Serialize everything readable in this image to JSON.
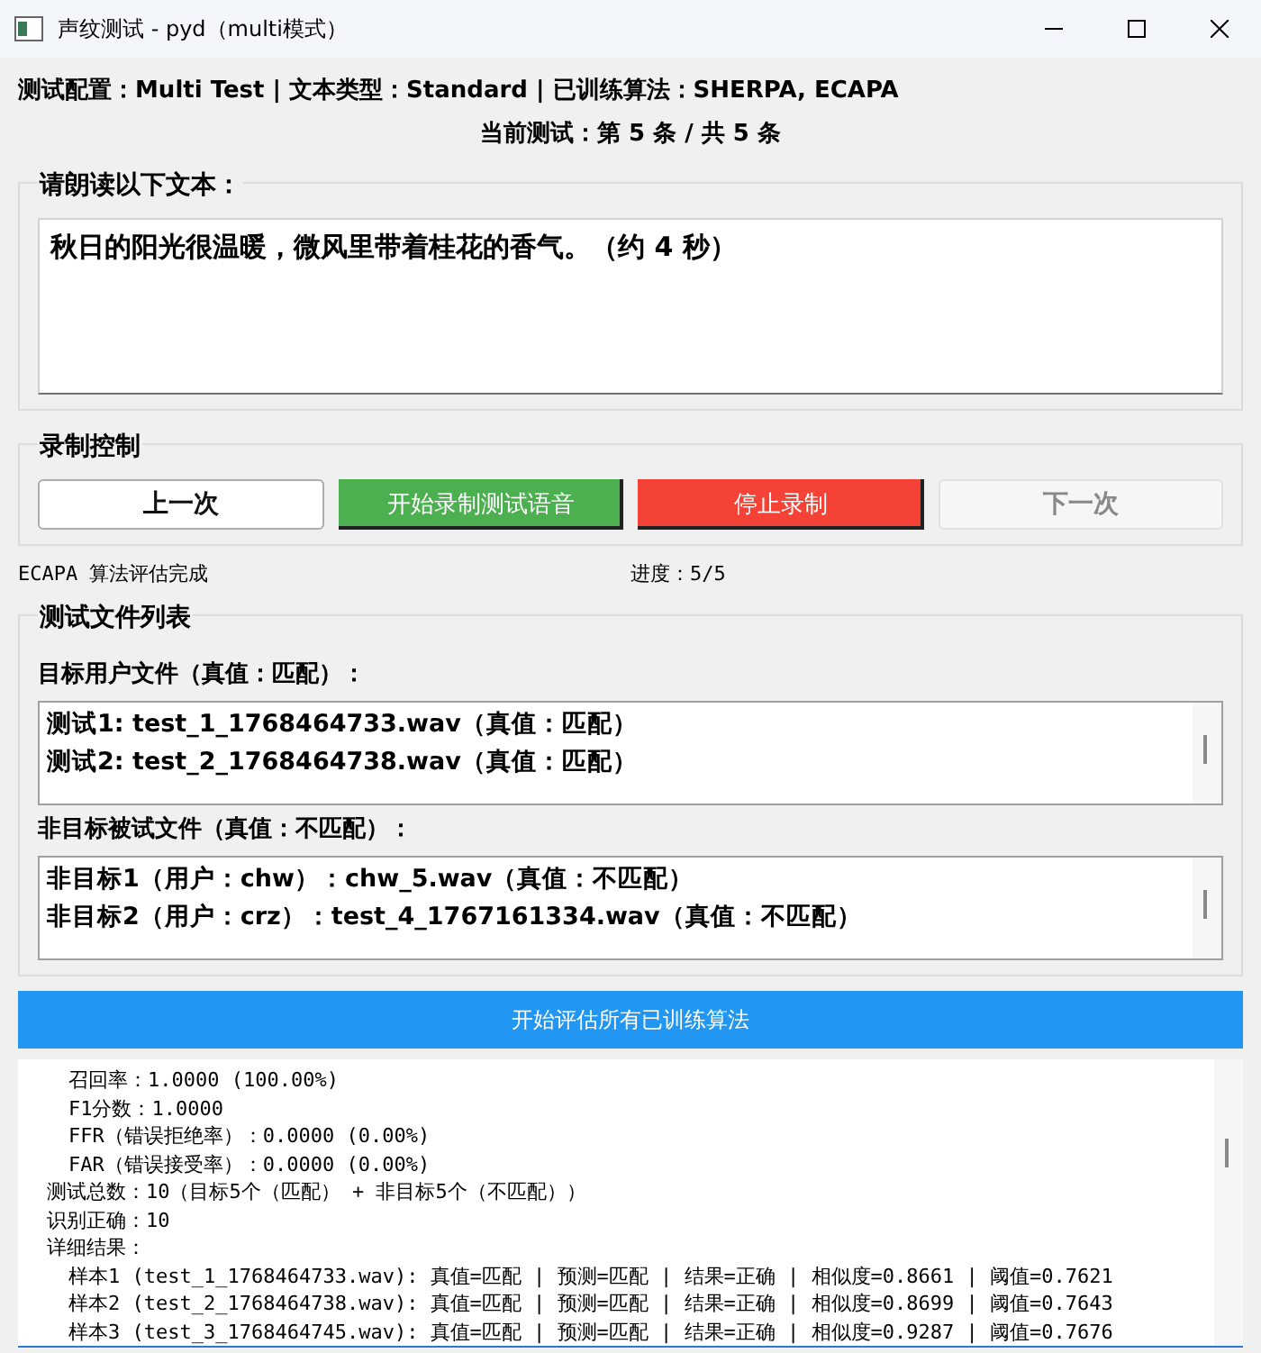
{
  "window": {
    "title": "声纹测试 - pyd（multi模式）"
  },
  "config_line": "测试配置：Multi Test | 文本类型：Standard | 已训练算法：SHERPA, ECAPA",
  "current_test": "当前测试：第 5 条 / 共 5 条",
  "read_group": {
    "title": "请朗读以下文本：",
    "text": "秋日的阳光很温暖，微风里带着桂花的香气。（约 4 秒）"
  },
  "record_group": {
    "title": "录制控制",
    "buttons": [
      {
        "label": "上一次",
        "kind": "plain",
        "disabled": false
      },
      {
        "label": "开始录制测试语音",
        "kind": "green",
        "disabled": false
      },
      {
        "label": "停止录制",
        "kind": "red",
        "disabled": false
      },
      {
        "label": "下一次",
        "kind": "plain",
        "disabled": true
      }
    ]
  },
  "status": {
    "message": "ECAPA 算法评估完成",
    "progress": "进度：5/5"
  },
  "files_group": {
    "title": "测试文件列表",
    "target_label": "目标用户文件（真值：匹配）：",
    "target_files": [
      "测试1: test_1_1768464733.wav（真值：匹配）",
      "测试2: test_2_1768464738.wav（真值：匹配）"
    ],
    "nontarget_label": "非目标被试文件（真值：不匹配）：",
    "nontarget_files": [
      "非目标1（用户：chw）：chw_5.wav（真值：不匹配）",
      "非目标2（用户：crz）：test_4_1767161334.wav（真值：不匹配）"
    ]
  },
  "evaluate_button": "开始评估所有已训练算法",
  "log": [
    {
      "kind": "metric",
      "text": "召回率：1.0000 (100.00%)"
    },
    {
      "kind": "metric",
      "text": "F1分数：1.0000"
    },
    {
      "kind": "metric",
      "text": "FFR（错误拒绝率）：0.0000 (0.00%)"
    },
    {
      "kind": "metric",
      "text": "FAR（错误接受率）：0.0000 (0.00%)"
    },
    {
      "kind": "summary",
      "text": "测试总数：10（目标5个（匹配） + 非目标5个（不匹配））"
    },
    {
      "kind": "summary",
      "text": "识别正确：10"
    },
    {
      "kind": "summary",
      "text": "详细结果："
    },
    {
      "kind": "sample",
      "text": "样本1 (test_1_1768464733.wav): 真值=匹配 | 预测=匹配 | 结果=正确 | 相似度=0.8661 | 阈值=0.7621"
    },
    {
      "kind": "sample",
      "text": "样本2 (test_2_1768464738.wav): 真值=匹配 | 预测=匹配 | 结果=正确 | 相似度=0.8699 | 阈值=0.7643"
    },
    {
      "kind": "sample",
      "text": "样本3 (test_3_1768464745.wav): 真值=匹配 | 预测=匹配 | 结果=正确 | 相似度=0.9287 | 阈值=0.7676"
    }
  ]
}
